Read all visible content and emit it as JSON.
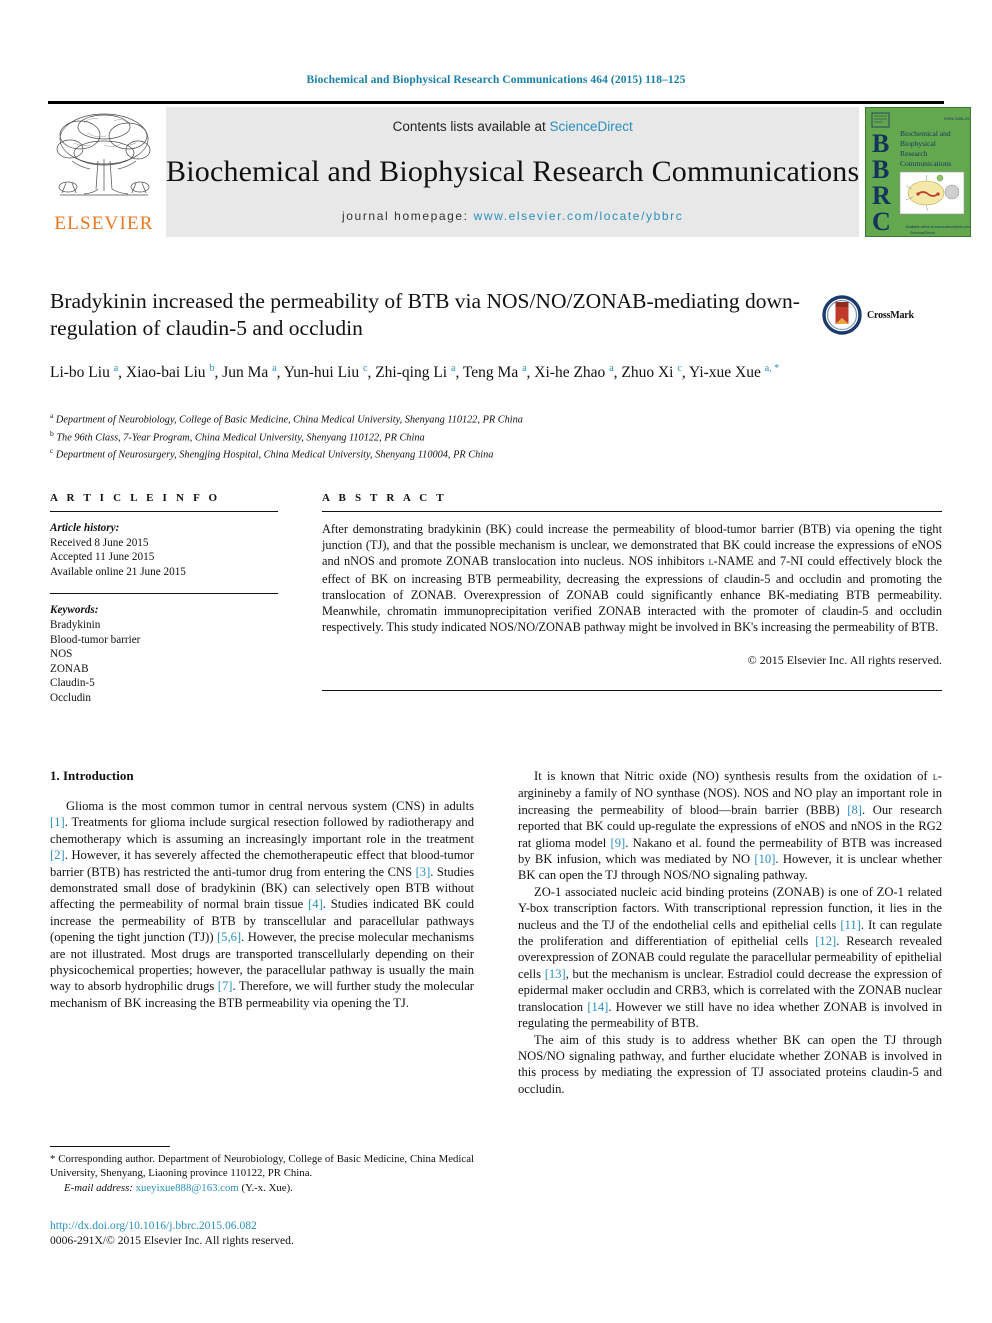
{
  "running_head": "Biochemical and Biophysical Research Communications 464 (2015) 118–125",
  "masthead": {
    "contents_prefix": "Contents lists available at ",
    "sciencedirect": "ScienceDirect",
    "journal_name": "Biochemical and Biophysical Research Communications",
    "homepage_prefix": "journal homepage: ",
    "homepage_url": "www.elsevier.com/locate/ybbrc",
    "publisher_wordmark": "ELSEVIER",
    "cover_letters": [
      "B",
      "B",
      "R",
      "C"
    ],
    "cover_title_lines": [
      "Biochemical and",
      "Biophysical",
      "Research",
      "Communications"
    ],
    "link_color": "#2a8fbd",
    "cover_bg_color": "#63a84f"
  },
  "article": {
    "title": "Bradykinin increased the permeability of BTB via NOS/NO/ZONAB-mediating down-regulation of claudin-5 and occludin",
    "crossmark_label": "CrossMark",
    "authors_html": "Li-bo Liu <sup>a</sup>, Xiao-bai Liu <sup>b</sup>, Jun Ma <sup>a</sup>, Yun-hui Liu <sup>c</sup>, Zhi-qing Li <sup>a</sup>, Teng Ma <sup>a</sup>, Xi-he Zhao <sup>a</sup>, Zhuo Xi <sup>c</sup>, Yi-xue Xue <sup>a, *</sup>",
    "affiliations": [
      {
        "marker": "a",
        "text": "Department of Neurobiology, College of Basic Medicine, China Medical University, Shenyang 110122, PR China"
      },
      {
        "marker": "b",
        "text": "The 96th Class, 7-Year Program, China Medical University, Shenyang 110122, PR China"
      },
      {
        "marker": "c",
        "text": "Department of Neurosurgery, Shengjing Hospital, China Medical University, Shenyang 110004, PR China"
      }
    ]
  },
  "article_info": {
    "heading": "A R T I C L E  I N F O",
    "history_label": "Article history:",
    "history": [
      "Received 8 June 2015",
      "Accepted 11 June 2015",
      "Available online 21 June 2015"
    ],
    "keywords_label": "Keywords:",
    "keywords": [
      "Bradykinin",
      "Blood-tumor barrier",
      "NOS",
      "ZONAB",
      "Claudin-5",
      "Occludin"
    ]
  },
  "abstract": {
    "heading": "A B S T R A C T",
    "body": "After demonstrating bradykinin (BK) could increase the permeability of blood-tumor barrier (BTB) via opening the tight junction (TJ), and that the possible mechanism is unclear, we demonstrated that BK could increase the expressions of eNOS and nNOS and promote ZONAB translocation into nucleus. NOS inhibitors L-NAME and 7-NI could effectively block the effect of BK on increasing BTB permeability, decreasing the expressions of claudin-5 and occludin and promoting the translocation of ZONAB. Overexpression of ZONAB could significantly enhance BK-mediating BTB permeability. Meanwhile, chromatin immunoprecipitation verified ZONAB interacted with the promoter of claudin-5 and occludin respectively. This study indicated NOS/NO/ZONAB pathway might be involved in BK's increasing the permeability of BTB.",
    "copyright": "© 2015 Elsevier Inc. All rights reserved."
  },
  "introduction": {
    "heading": "1.  Introduction",
    "left_paragraphs": [
      "Glioma is the most common tumor in central nervous system (CNS) in adults [1]. Treatments for glioma include surgical resection followed by radiotherapy and chemotherapy which is assuming an increasingly important role in the treatment [2]. However, it has severely affected the chemotherapeutic effect that blood-tumor barrier (BTB) has restricted the anti-tumor drug from entering the CNS [3]. Studies demonstrated small dose of bradykinin (BK) can selectively open BTB without affecting the permeability of normal brain tissue [4]. Studies indicated BK could increase the permeability of BTB by transcellular and paracellular pathways (opening the tight junction (TJ)) [5,6]. However, the precise molecular mechanisms are not illustrated. Most drugs are transported transcellularly depending on their physicochemical properties; however, the paracellular pathway is usually the main way to absorb hydrophilic drugs [7]. Therefore, we will further study the molecular mechanism of BK increasing the BTB permeability via opening the TJ."
    ],
    "right_paragraphs": [
      "It is known that Nitric oxide (NO) synthesis results from the oxidation of L-arginineby a family of NO synthase (NOS). NOS and NO play an important role in increasing the permeability of blood—brain barrier (BBB) [8]. Our research reported that BK could up-regulate the expressions of eNOS and nNOS in the RG2 rat glioma model [9]. Nakano et al. found the permeability of BTB was increased by BK infusion, which was mediated by NO [10]. However, it is unclear whether BK can open the TJ through NOS/NO signaling pathway.",
      "ZO-1 associated nucleic acid binding proteins (ZONAB) is one of ZO-1 related Y-box transcription factors. With transcriptional repression function, it lies in the nucleus and the TJ of the endothelial cells and epithelial cells [11]. It can regulate the proliferation and differentiation of epithelial cells [12]. Research revealed overexpression of ZONAB could regulate the paracellular permeability of epithelial cells [13], but the mechanism is unclear. Estradiol could decrease the expression of epidermal maker occludin and CRB3, which is correlated with the ZONAB nuclear translocation [14]. However we still have no idea whether ZONAB is involved in regulating the permeability of BTB.",
      "The aim of this study is to address whether BK can open the TJ through NOS/NO signaling pathway, and further elucidate whether ZONAB is involved in this process by mediating the expression of TJ associated proteins claudin-5 and occludin."
    ]
  },
  "footnote": {
    "corresponding": "* Corresponding author. Department of Neurobiology, College of Basic Medicine, China Medical University, Shenyang, Liaoning province 110122, PR China.",
    "email_label": "E-mail address:",
    "email": "xueyixue888@163.com",
    "email_suffix": "(Y.-x. Xue)."
  },
  "footer": {
    "doi": "http://dx.doi.org/10.1016/j.bbrc.2015.06.082",
    "issn_line": "0006-291X/© 2015 Elsevier Inc. All rights reserved."
  }
}
